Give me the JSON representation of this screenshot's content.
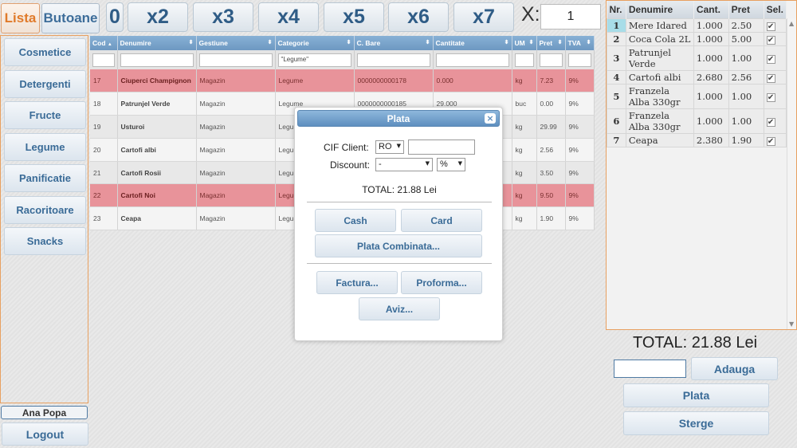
{
  "tabs": [
    {
      "label": "Lista",
      "active": true
    },
    {
      "label": "Butoane",
      "active": false
    }
  ],
  "quantity_buttons": [
    "0",
    "x2",
    "x3",
    "x4",
    "x5",
    "x6",
    "x7"
  ],
  "multiplier": {
    "label": "X:",
    "value": "1"
  },
  "categories": [
    "Cosmetice",
    "Detergenti",
    "Fructe",
    "Legume",
    "Panificatie",
    "Racoritoare",
    "Snacks"
  ],
  "user": "Ana Popa",
  "logout_label": "Logout",
  "grid": {
    "columns": [
      "Cod",
      "Denumire",
      "Gestiune",
      "Categorie",
      "C. Bare",
      "Cantitate",
      "UM",
      "Pret",
      "TVA"
    ],
    "sort_indicators": [
      "▲",
      "⬍",
      "⬍",
      "⬍",
      "⬍",
      "⬍",
      "⬍",
      "⬍",
      "⬍"
    ],
    "filter_categorie": "\"Legume\"",
    "rows": [
      {
        "cod": "17",
        "denumire": "Ciuperci Champignon",
        "gestiune": "Magazin",
        "categorie": "Legume",
        "cbare": "0000000000178",
        "cantitate": "0.000",
        "um": "kg",
        "pret": "7.23",
        "tva": "9%",
        "style": "hl"
      },
      {
        "cod": "18",
        "denumire": "Patrunjel Verde",
        "gestiune": "Magazin",
        "categorie": "Legume",
        "cbare": "0000000000185",
        "cantitate": "29.000",
        "um": "buc",
        "pret": "0.00",
        "tva": "9%",
        "style": "norm"
      },
      {
        "cod": "19",
        "denumire": "Usturoi",
        "gestiune": "Magazin",
        "categorie": "Legu",
        "cbare": "",
        "cantitate": "",
        "um": "kg",
        "pret": "29.99",
        "tva": "9%",
        "style": "alt"
      },
      {
        "cod": "20",
        "denumire": "Cartofi albi",
        "gestiune": "Magazin",
        "categorie": "Legu",
        "cbare": "",
        "cantitate": "",
        "um": "kg",
        "pret": "2.56",
        "tva": "9%",
        "style": "norm"
      },
      {
        "cod": "21",
        "denumire": "Cartofi Rosii",
        "gestiune": "Magazin",
        "categorie": "Legu",
        "cbare": "",
        "cantitate": "",
        "um": "kg",
        "pret": "3.50",
        "tva": "9%",
        "style": "alt"
      },
      {
        "cod": "22",
        "denumire": "Cartofi Noi",
        "gestiune": "Magazin",
        "categorie": "Legu",
        "cbare": "",
        "cantitate": "",
        "um": "kg",
        "pret": "9.50",
        "tva": "9%",
        "style": "hl"
      },
      {
        "cod": "23",
        "denumire": "Ceapa",
        "gestiune": "Magazin",
        "categorie": "Legu",
        "cbare": "",
        "cantitate": "",
        "um": "kg",
        "pret": "1.90",
        "tva": "9%",
        "style": "norm"
      }
    ]
  },
  "cart": {
    "columns": [
      "Nr.",
      "Denumire",
      "Cant.",
      "Pret",
      "Sel."
    ],
    "rows": [
      {
        "nr": "1",
        "denumire": "Mere Idared",
        "cant": "1.000",
        "pret": "2.50",
        "sel": "✔"
      },
      {
        "nr": "2",
        "denumire": "Coca Cola 2L",
        "cant": "1.000",
        "pret": "5.00",
        "sel": "✔"
      },
      {
        "nr": "3",
        "denumire": "Patrunjel Verde",
        "cant": "1.000",
        "pret": "1.00",
        "sel": "✔"
      },
      {
        "nr": "4",
        "denumire": "Cartofi albi",
        "cant": "2.680",
        "pret": "2.56",
        "sel": "✔"
      },
      {
        "nr": "5",
        "denumire": "Franzela Alba 330gr",
        "cant": "1.000",
        "pret": "1.00",
        "sel": "✔"
      },
      {
        "nr": "6",
        "denumire": "Franzela Alba 330gr",
        "cant": "1.000",
        "pret": "1.00",
        "sel": "✔"
      },
      {
        "nr": "7",
        "denumire": "Ceapa",
        "cant": "2.380",
        "pret": "1.90",
        "sel": "✔"
      }
    ]
  },
  "total": "TOTAL: 21.88 Lei",
  "right_buttons": {
    "adauga": "Adauga",
    "plata": "Plata",
    "sterge": "Sterge"
  },
  "modal": {
    "title": "Plata",
    "close": "×",
    "cif_label": "CIF Client:",
    "cif_prefix": "RO",
    "discount_label": "Discount:",
    "discount_value": "-",
    "discount_unit": "%",
    "total": "TOTAL: 21.88 Lei",
    "buttons": {
      "cash": "Cash",
      "card": "Card",
      "combinata": "Plata Combinata...",
      "factura": "Factura...",
      "proforma": "Proforma...",
      "aviz": "Aviz..."
    }
  },
  "colors": {
    "accent_orange": "#e07a2a",
    "header_blue": "#6d98c1",
    "highlight_row": "#e8939a",
    "button_text": "#3a6b97"
  }
}
